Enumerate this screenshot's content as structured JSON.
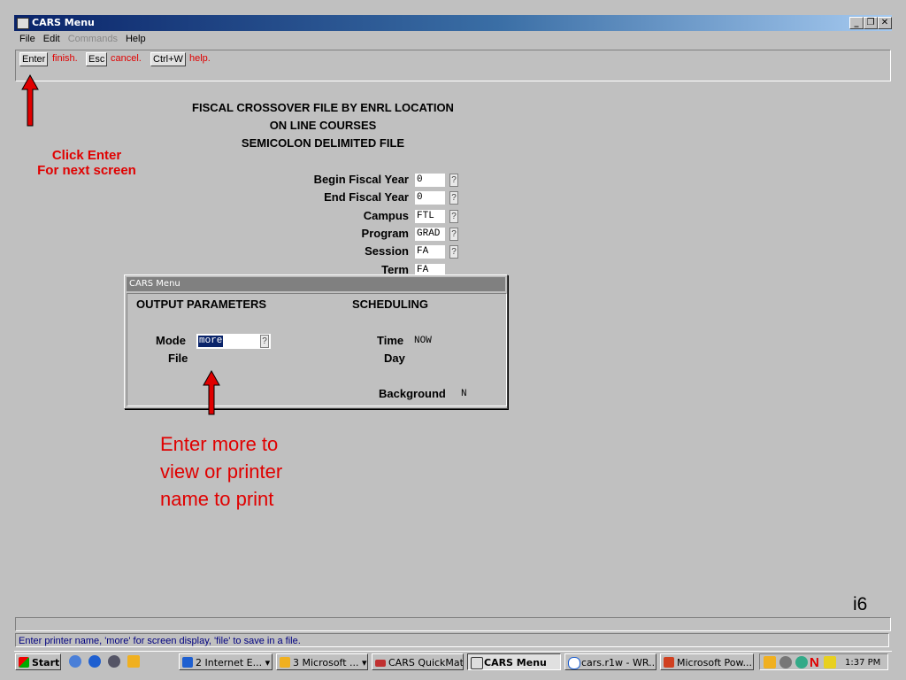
{
  "window": {
    "title": "CARS Menu"
  },
  "menu": [
    "File",
    "Edit",
    "Commands",
    "Help"
  ],
  "toolbar": [
    {
      "key": "Enter",
      "action": "finish."
    },
    {
      "key": "Esc",
      "action": "cancel."
    },
    {
      "key": "Ctrl+W",
      "action": "help."
    }
  ],
  "heading": {
    "line1": "FISCAL CROSSOVER FILE BY ENRL LOCATION",
    "line2": "ON LINE COURSES",
    "line3": "SEMICOLON DELIMITED FILE"
  },
  "fields": [
    {
      "label": "Begin Fiscal Year",
      "value": "0",
      "lookup": "?"
    },
    {
      "label": "End Fiscal Year",
      "value": "0",
      "lookup": "?"
    },
    {
      "label": "Campus",
      "value": "FTL",
      "lookup": "?"
    },
    {
      "label": "Program",
      "value": "GRAD",
      "lookup": "?"
    },
    {
      "label": "Session",
      "value": "FA",
      "lookup": "?"
    },
    {
      "label": "Term",
      "value": "FA",
      "lookup": ""
    }
  ],
  "annotations": {
    "click_enter": "Click Enter",
    "next_screen": "For next screen",
    "enter_more_1": "Enter more to",
    "enter_more_2": "view or printer",
    "enter_more_3": "name to print",
    "slide_id": "i6"
  },
  "dialog": {
    "title": "CARS Menu",
    "output_header": "OUTPUT PARAMETERS",
    "scheduling_header": "SCHEDULING",
    "mode_label": "Mode",
    "mode_value": "more",
    "mode_lookup": "?",
    "file_label": "File",
    "time_label": "Time",
    "time_value": "NOW",
    "day_label": "Day",
    "background_label": "Background",
    "background_value": "N"
  },
  "status": {
    "message": "Enter printer name, 'more' for screen display, 'file' to save in a file."
  },
  "taskbar": {
    "start": "Start",
    "items": [
      {
        "label": "2 Internet E...",
        "icon": "ie-icon"
      },
      {
        "label": "3 Microsoft ...",
        "icon": "outlook-icon"
      },
      {
        "label": "CARS QuickMate",
        "icon": "quickmate-icon"
      },
      {
        "label": "CARS Menu",
        "icon": "cars-icon"
      },
      {
        "label": "cars.r1w - WR...",
        "icon": "hp-icon"
      },
      {
        "label": "Microsoft Pow...",
        "icon": "powerpoint-icon"
      }
    ],
    "clock": "1:37 PM"
  },
  "colors": {
    "accent_red": "#e00000",
    "titlebar": "#0a246a",
    "status_text": "#000080"
  }
}
